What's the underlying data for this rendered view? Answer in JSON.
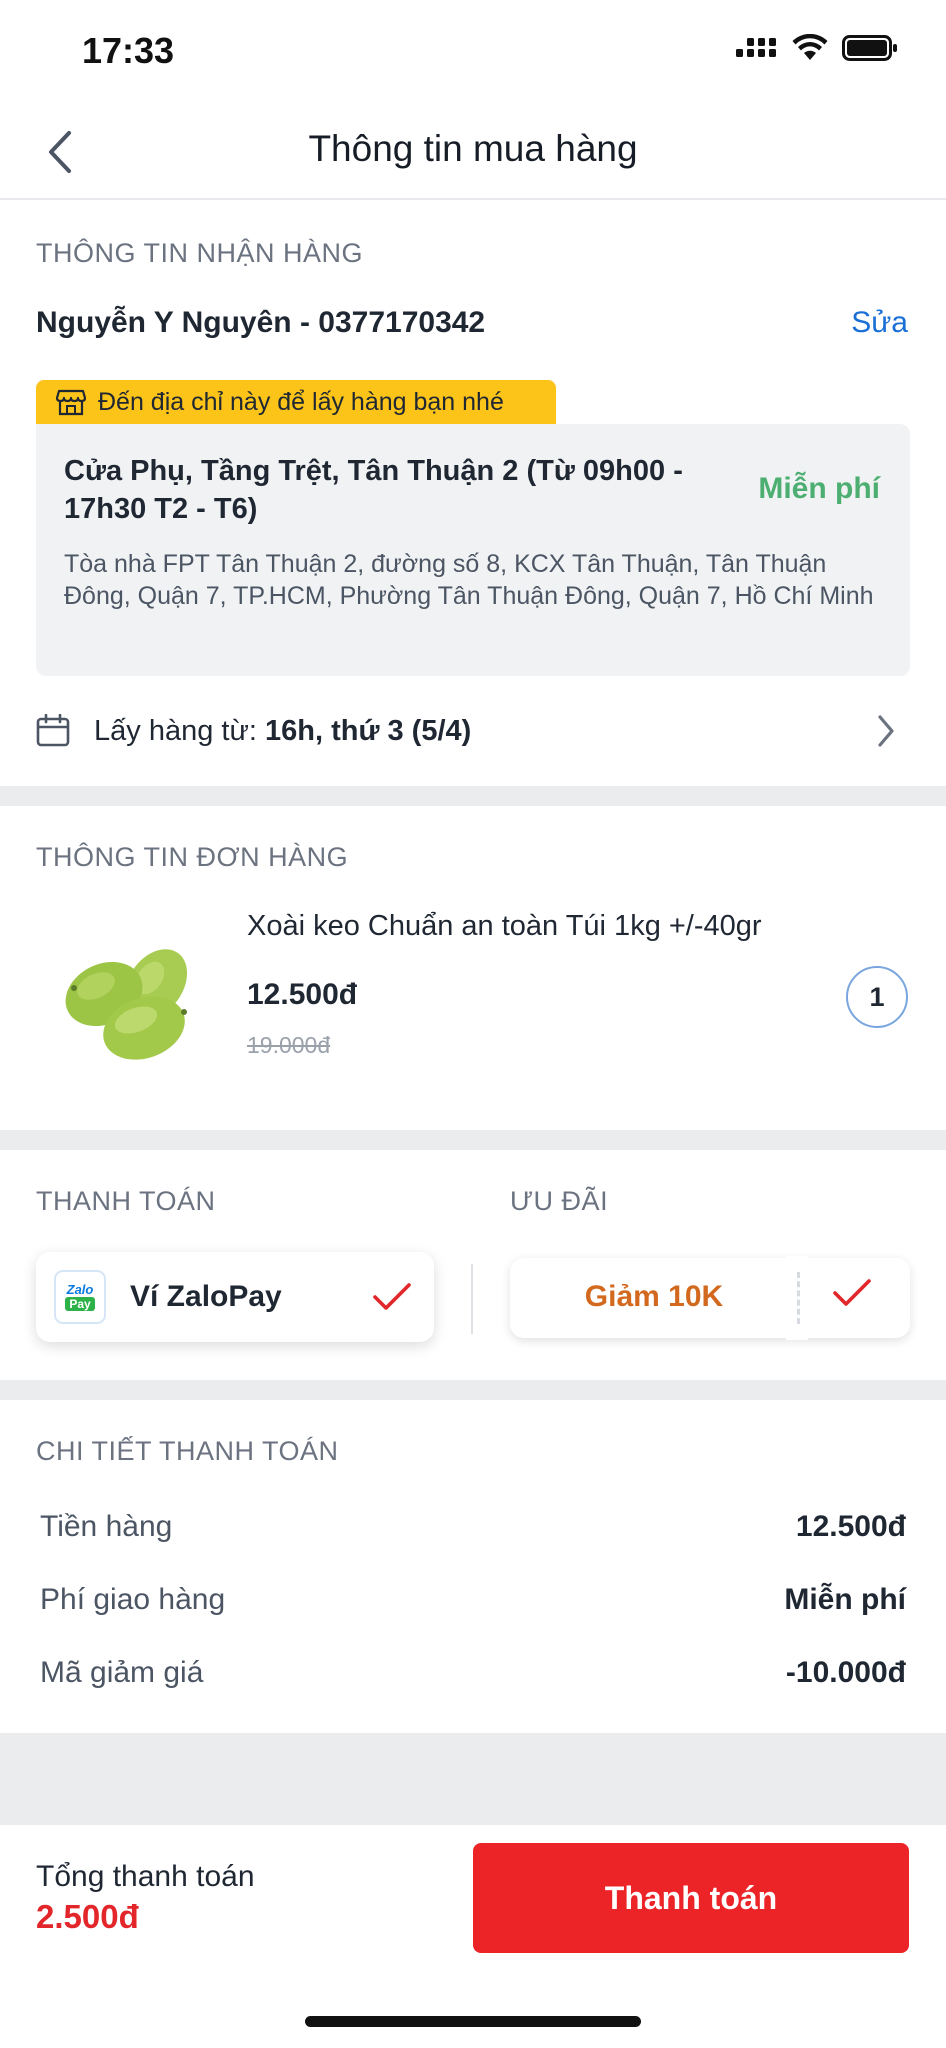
{
  "status_bar": {
    "time": "17:33"
  },
  "header": {
    "title": "Thông tin mua hàng"
  },
  "receiving": {
    "section_label": "THÔNG TIN NHẬN HÀNG",
    "receiver": "Nguyễn Y Nguyên - 0377170342",
    "edit_label": "Sửa",
    "banner": "Đến địa chỉ này để lấy hàng bạn nhé",
    "store_name": "Cửa Phụ, Tầng Trệt, Tân Thuận 2 (Từ 09h00 - 17h30 T2 - T6)",
    "fee": "Miễn phí",
    "address": "Tòa nhà FPT Tân Thuận 2, đường số 8, KCX Tân Thuận, Tân Thuận Đông, Quận 7, TP.HCM, Phường Tân Thuận Đông, Quận 7, Hồ Chí Minh",
    "pickup_label": "Lấy hàng từ:",
    "pickup_time": "16h, thứ 3 (5/4)"
  },
  "order": {
    "section_label": "THÔNG TIN ĐƠN HÀNG",
    "product_name": "Xoài keo Chuẩn an toàn Túi 1kg +/-40gr",
    "price": "12.500đ",
    "old_price": "19.000đ",
    "quantity": "1"
  },
  "payment": {
    "section_label": "THANH TOÁN",
    "method": "Ví ZaloPay",
    "logo_text_top": "Zalo",
    "logo_text_bottom": "Pay"
  },
  "promo": {
    "section_label": "ƯU ĐÃI",
    "label": "Giảm 10K"
  },
  "details": {
    "section_label": "CHI TIẾT THANH TOÁN",
    "rows": [
      {
        "key": "Tiền hàng",
        "value": "12.500đ"
      },
      {
        "key": "Phí giao hàng",
        "value": "Miễn phí"
      },
      {
        "key": "Mã giảm giá",
        "value": "-10.000đ"
      }
    ]
  },
  "footer": {
    "total_label": "Tổng thanh toán",
    "total_value": "2.500đ",
    "pay_button": "Thanh toán"
  },
  "colors": {
    "accent_red": "#ec2327",
    "link_blue": "#1a6fd6",
    "free_green": "#4caf71",
    "banner_yellow": "#fcc419",
    "promo_orange": "#d2691e"
  }
}
